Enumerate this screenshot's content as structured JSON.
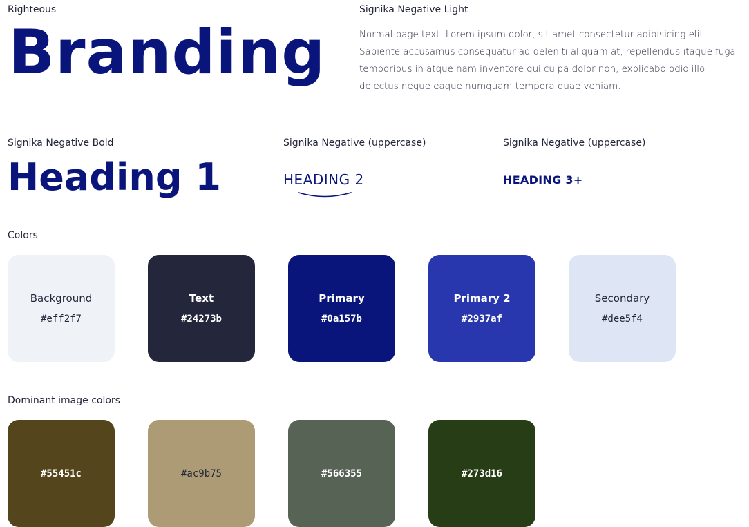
{
  "branding": {
    "font_caption": "Righteous",
    "word": "Branding"
  },
  "body_sample": {
    "font_caption": "Signika Negative Light",
    "text": "Normal page text. Lorem ipsum dolor, sit amet consectetur adipisicing elit. Sapiente accusamus consequatur ad deleniti aliquam at, repellendus itaque fuga temporibus in atque nam inventore qui culpa dolor non, explicabo odio illo delectus neque eaque numquam tempora quae veniam."
  },
  "headings": {
    "h1": {
      "font_caption": "Signika Negative Bold",
      "text": "Heading 1"
    },
    "h2": {
      "font_caption": "Signika Negative (uppercase)",
      "text": "HEADING 2"
    },
    "h3": {
      "font_caption": "Signika Negative (uppercase)",
      "text": "HEADING 3+"
    }
  },
  "colors": {
    "section_title": "Colors",
    "swatches": [
      {
        "name": "Background",
        "hex": "#eff2f7",
        "color": "#eff2f7",
        "text_color": "#24273b"
      },
      {
        "name": "Text",
        "hex": "#24273b",
        "color": "#24273b",
        "text_color": "#ffffff"
      },
      {
        "name": "Primary",
        "hex": "#0a157b",
        "color": "#0a157b",
        "text_color": "#ffffff"
      },
      {
        "name": "Primary 2",
        "hex": "#2937af",
        "color": "#2937af",
        "text_color": "#ffffff"
      },
      {
        "name": "Secondary",
        "hex": "#dee5f4",
        "color": "#dee5f4",
        "text_color": "#24273b"
      }
    ]
  },
  "dominant": {
    "section_title": "Dominant image colors",
    "swatches": [
      {
        "hex": "#55451c",
        "color": "#55451c",
        "text_color": "#ffffff"
      },
      {
        "hex": "#ac9b75",
        "color": "#ac9b75",
        "text_color": "#24273b"
      },
      {
        "hex": "#566355",
        "color": "#566355",
        "text_color": "#ffffff"
      },
      {
        "hex": "#273d16",
        "color": "#273d16",
        "text_color": "#ffffff"
      }
    ]
  }
}
